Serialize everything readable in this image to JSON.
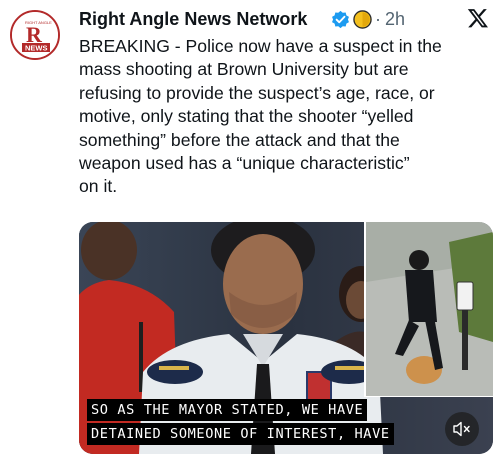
{
  "post": {
    "author": "Right Angle News Network",
    "time": "2h",
    "separator": "·",
    "avatar_logo": {
      "letter": "R",
      "small_text": "RIGHT ANGLE",
      "band_text": "NEWS",
      "color": "#b32a2a"
    },
    "text_lines": [
      "BREAKING - Police now have a suspect in the",
      "mass shooting at Brown University but are",
      "refusing to provide the suspect’s age, race, or",
      "motive, only stating that the shooter “yelled",
      "something” before the attack and that the",
      "weapon used has a “unique characteristic”",
      "on it."
    ],
    "icons": {
      "verified": "verified-badge-icon",
      "affiliate": "gold-coin-icon",
      "platform": "x-logo-icon",
      "mute": "speaker-muted-icon"
    }
  },
  "media": {
    "caption_line1": "SO AS THE MAYOR STATED, WE HAVE",
    "caption_line2": "DETAINED SOMEONE OF INTEREST, HAVE",
    "colors": {
      "uniform": "#e8ecef",
      "background": "#2c3543",
      "red_shirt": "#c22a22"
    }
  },
  "colors": {
    "text": "#0f1419",
    "muted": "#536471",
    "verified": "#1d9bf0",
    "accent": "#b32a2a"
  }
}
